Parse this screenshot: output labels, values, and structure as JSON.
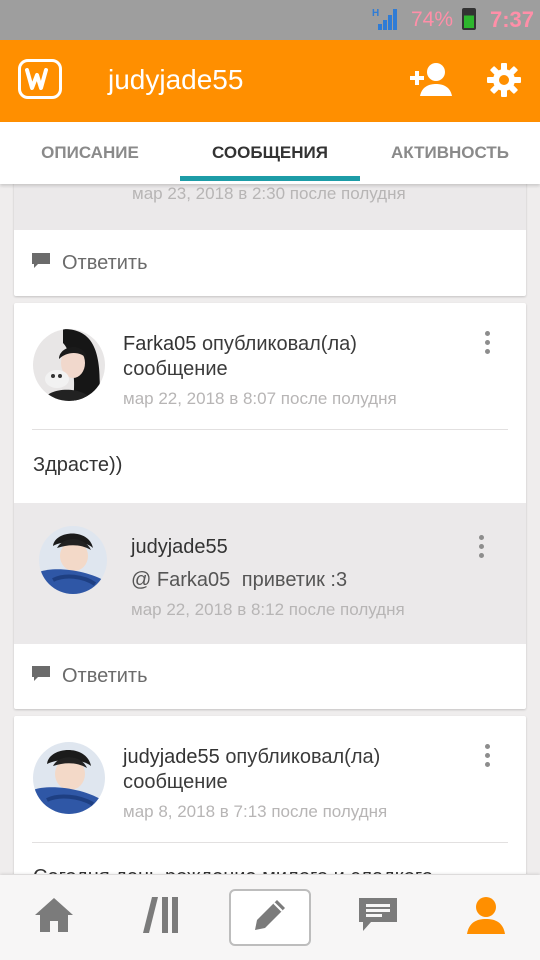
{
  "status": {
    "battery": "74%",
    "time": "7:37"
  },
  "app": {
    "username": "judyjade55"
  },
  "tabs": [
    "ОПИСАНИЕ",
    "СООБЩЕНИЯ",
    "АКТИВНОСТЬ"
  ],
  "feed": {
    "top_card": {
      "reply_meta": "мар 23, 2018 в 2:30 после полудня",
      "reply_label": "Ответить"
    },
    "post1": {
      "author": "Farka05",
      "action_line1": "опубликовал(ла)",
      "action_line2": "сообщение",
      "date": "мар 22, 2018 в 8:07 после полудня",
      "body": "Здрасте))",
      "reply": {
        "author": "judyjade55",
        "mention": "@ Farka05",
        "text": "приветик :3",
        "date": "мар 22, 2018 в 8:12 после полудня"
      },
      "reply_label": "Ответить"
    },
    "post2": {
      "author": "judyjade55",
      "action_line1": "опубликовал(ла)",
      "action_line2": "сообщение",
      "date": "мар 8, 2018 в 7:13 после полудня",
      "body": "Сегодня день рождение милого и сладкого"
    }
  },
  "bottom_nav": [
    {
      "icon": "home-icon"
    },
    {
      "icon": "library-icon"
    },
    {
      "icon": "pencil-icon"
    },
    {
      "icon": "messages-icon"
    },
    {
      "icon": "profile-icon"
    }
  ],
  "colors": {
    "brand": "#ff8f00",
    "tab_indicator": "#1d9ca7",
    "accent_profile": "#ff8f00"
  }
}
